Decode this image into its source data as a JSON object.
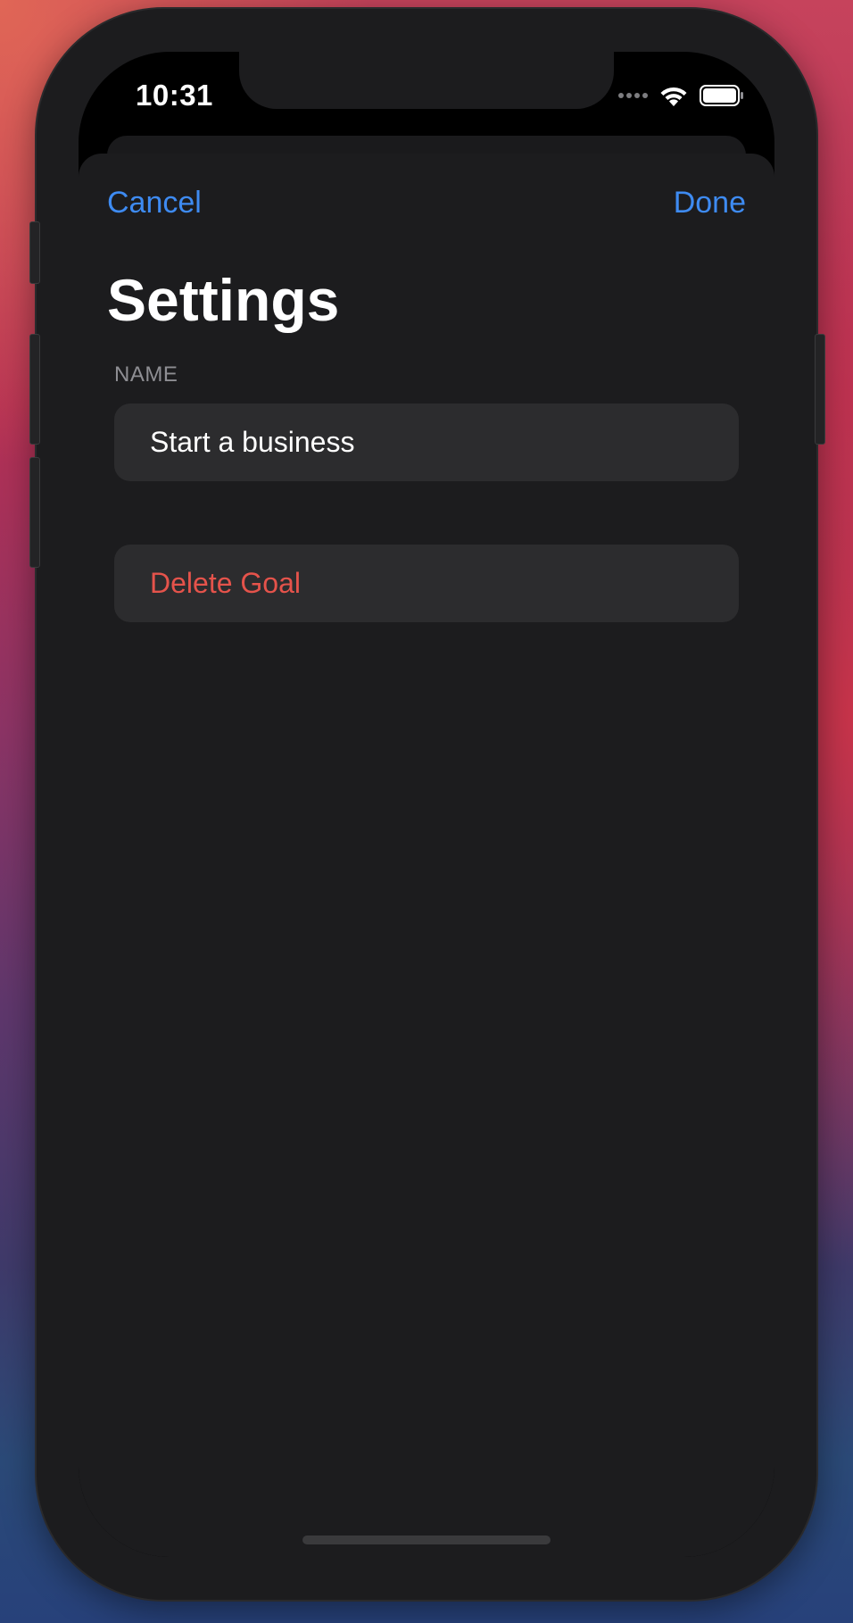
{
  "status_bar": {
    "time": "10:31",
    "icons": [
      "signal-dots-icon",
      "wifi-icon",
      "battery-icon"
    ]
  },
  "nav": {
    "cancel_label": "Cancel",
    "done_label": "Done"
  },
  "page": {
    "title": "Settings"
  },
  "name_section": {
    "header": "NAME",
    "value": "Start a business"
  },
  "actions": {
    "delete_label": "Delete Goal"
  },
  "colors": {
    "accent": "#3e8bf2",
    "destructive": "#e5534b",
    "background": "#1c1c1e",
    "cell": "#2c2c2e"
  }
}
